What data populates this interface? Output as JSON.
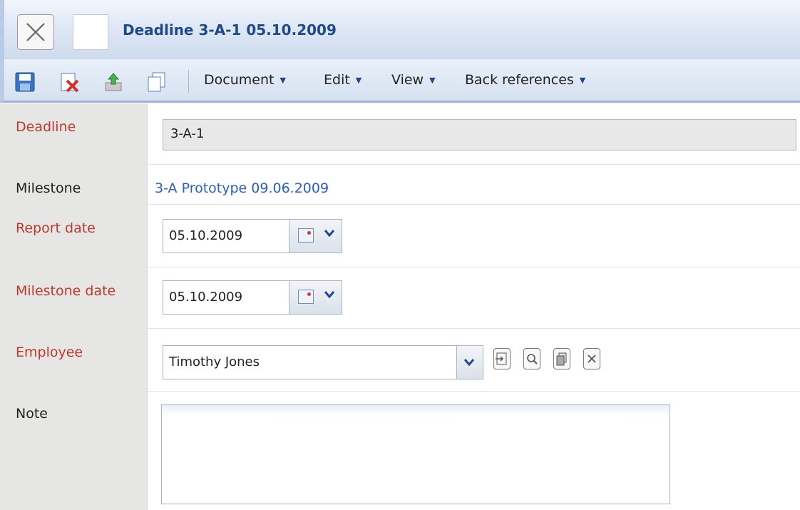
{
  "window": {
    "title": "Deadline 3-A-1 05.10.2009"
  },
  "toolbar": {
    "menus": [
      {
        "label": "Document"
      },
      {
        "label": "Edit"
      },
      {
        "label": "View"
      },
      {
        "label": "Back references"
      }
    ]
  },
  "form": {
    "deadline": {
      "label": "Deadline",
      "value": "3-A-1"
    },
    "milestone": {
      "label": "Milestone",
      "value": "3-A Prototype 09.06.2009"
    },
    "report_date": {
      "label": "Report date",
      "value": "05.10.2009"
    },
    "milestone_date": {
      "label": "Milestone date",
      "value": "05.10.2009"
    },
    "employee": {
      "label": "Employee",
      "value": "Timothy Jones"
    },
    "note": {
      "label": "Note",
      "value": ""
    }
  },
  "colors": {
    "required_label": "#c0392b",
    "link": "#2a5ec9",
    "title": "#1e4a8c"
  }
}
